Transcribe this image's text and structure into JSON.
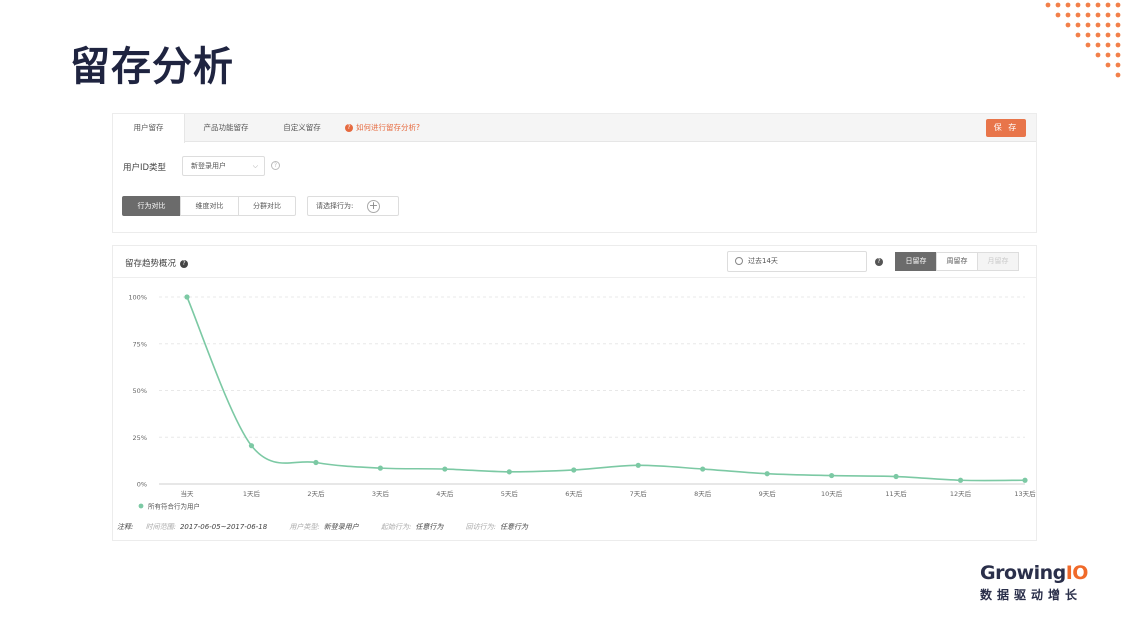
{
  "slide": {
    "title": "留存分析"
  },
  "tabs": [
    {
      "label": "用户留存",
      "active": true
    },
    {
      "label": "产品功能留存",
      "active": false
    },
    {
      "label": "自定义留存",
      "active": false
    }
  ],
  "help_link": "如何进行留存分析?",
  "save_label": "保 存",
  "filters": {
    "user_id_label": "用户ID类型",
    "user_id_value": "新登录用户",
    "segments": [
      {
        "label": "行为对比",
        "active": true
      },
      {
        "label": "维度对比",
        "active": false
      },
      {
        "label": "分群对比",
        "active": false
      }
    ],
    "behavior_placeholder": "请选择行为:"
  },
  "overview": {
    "title": "留存趋势概况",
    "date_range": "过去14天",
    "modes": [
      {
        "label": "日留存",
        "state": "active"
      },
      {
        "label": "周留存",
        "state": "normal"
      },
      {
        "label": "月留存",
        "state": "disabled"
      }
    ]
  },
  "chart_data": {
    "type": "line",
    "x": [
      "当天",
      "1天后",
      "2天后",
      "3天后",
      "4天后",
      "5天后",
      "6天后",
      "7天后",
      "8天后",
      "9天后",
      "10天后",
      "11天后",
      "12天后",
      "13天后"
    ],
    "series": [
      {
        "name": "所有符合行为用户",
        "values": [
          100,
          20.5,
          11.5,
          8.5,
          8,
          6.5,
          7.5,
          10,
          8,
          5.5,
          4.5,
          4,
          2,
          2
        ]
      }
    ],
    "y_ticks": [
      "0%",
      "25%",
      "50%",
      "75%",
      "100%"
    ],
    "ylim": [
      0,
      100
    ],
    "grid": true,
    "legend": "bottom-left",
    "color": "#7cc9a4"
  },
  "notes": {
    "label": "注释:",
    "items": [
      {
        "key": "时间范围:",
        "value": "2017-06-05~2017-06-18"
      },
      {
        "key": "用户类型:",
        "value": "新登录用户"
      },
      {
        "key": "起始行为:",
        "value": "任意行为"
      },
      {
        "key": "回访行为:",
        "value": "任意行为"
      }
    ]
  },
  "brand": {
    "name_main": "Growing",
    "name_accent": "IO",
    "tagline": "数据驱动增长",
    "accent_color": "#f06a2a"
  }
}
